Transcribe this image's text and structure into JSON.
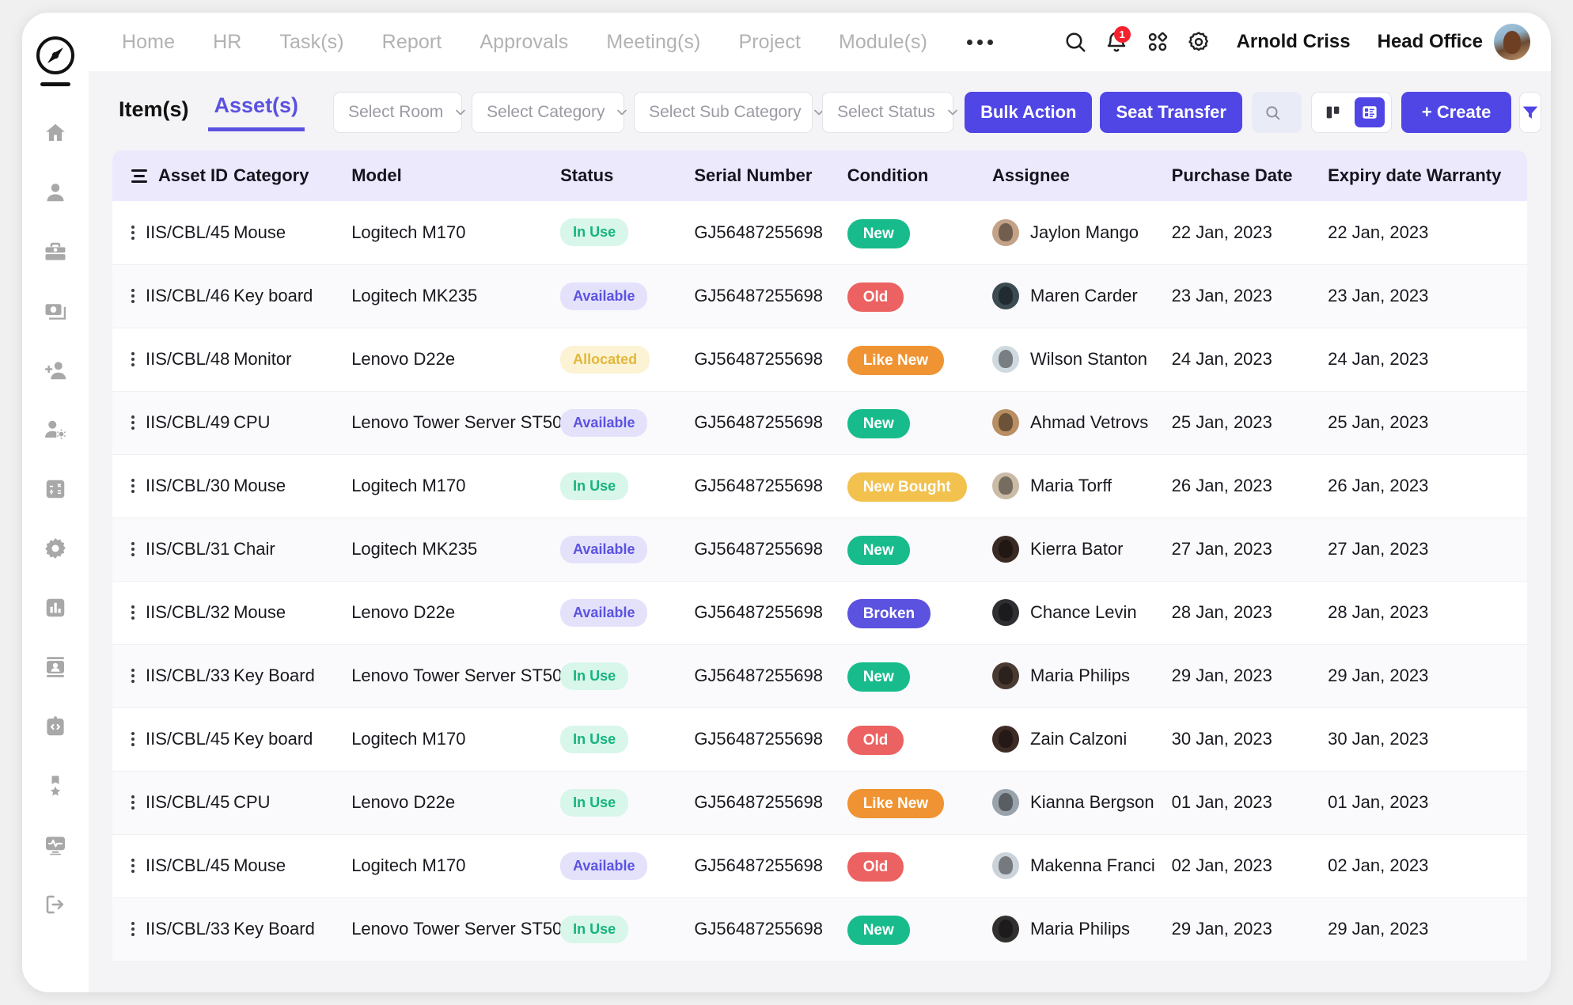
{
  "topnav": {
    "items": [
      {
        "label": "Home"
      },
      {
        "label": "HR"
      },
      {
        "label": "Task(s)"
      },
      {
        "label": "Report"
      },
      {
        "label": "Approvals"
      },
      {
        "label": "Meeting(s)"
      },
      {
        "label": "Project"
      },
      {
        "label": "Module(s)"
      }
    ],
    "overflow_label": "•••",
    "notification_count": "1",
    "user_name": "Arnold Criss",
    "office_name": "Head Office"
  },
  "sidebar": {
    "items": [
      {
        "icon": "compass-logo-icon",
        "label": "Logo"
      },
      {
        "icon": "home-icon",
        "label": "Home"
      },
      {
        "icon": "user-icon",
        "label": "Profile"
      },
      {
        "icon": "briefcase-icon",
        "label": "Jobs"
      },
      {
        "icon": "payment-icon",
        "label": "Payroll"
      },
      {
        "icon": "add-user-icon",
        "label": "Add User"
      },
      {
        "icon": "user-settings-icon",
        "label": "User Settings"
      },
      {
        "icon": "calculator-icon",
        "label": "Accounts"
      },
      {
        "icon": "gear-icon",
        "label": "Settings"
      },
      {
        "icon": "chart-icon",
        "label": "Reports"
      },
      {
        "icon": "contact-card-icon",
        "label": "Contacts"
      },
      {
        "icon": "code-clipboard-icon",
        "label": "Developer"
      },
      {
        "icon": "award-icon",
        "label": "Awards"
      },
      {
        "icon": "activity-monitor-icon",
        "label": "Monitoring"
      },
      {
        "icon": "logout-icon",
        "label": "Logout"
      }
    ]
  },
  "toolbar": {
    "tabs": [
      {
        "label": "Item(s)",
        "active": false
      },
      {
        "label": "Asset(s)",
        "active": true
      }
    ],
    "selects": [
      {
        "placeholder": "Select Room"
      },
      {
        "placeholder": "Select Category"
      },
      {
        "placeholder": "Select Sub Category"
      },
      {
        "placeholder": "Select Status"
      }
    ],
    "bulk_action_label": "Bulk Action",
    "seat_transfer_label": "Seat Transfer",
    "search_placeholder": "Search",
    "search_value": "",
    "create_label": "+ Create",
    "view_board_label": "Board view",
    "view_list_label": "List view",
    "filter_label": "Filter"
  },
  "table": {
    "columns": [
      "Asset ID",
      "Category",
      "Model",
      "Status",
      "Serial Number",
      "Condition",
      "Assignee",
      "Purchase Date",
      "Expiry date Warranty"
    ],
    "rows": [
      {
        "asset_id": "IIS/CBL/45",
        "category": "Mouse",
        "model": "Logitech M170",
        "status": "In Use",
        "serial": "GJ56487255698",
        "condition": "New",
        "assignee": "Jaylon Mango",
        "purchase_date": "22 Jan, 2023",
        "expiry_date": "22 Jan, 2023"
      },
      {
        "asset_id": "IIS/CBL/46",
        "category": "Key board",
        "model": "Logitech MK235",
        "status": "Available",
        "serial": "GJ56487255698",
        "condition": "Old",
        "assignee": "Maren Carder",
        "purchase_date": "23 Jan, 2023",
        "expiry_date": "23 Jan, 2023"
      },
      {
        "asset_id": "IIS/CBL/48",
        "category": "Monitor",
        "model": "Lenovo D22e",
        "status": "Allocated",
        "serial": "GJ56487255698",
        "condition": "Like New",
        "assignee": "Wilson Stanton",
        "purchase_date": "24 Jan, 2023",
        "expiry_date": "24 Jan, 2023"
      },
      {
        "asset_id": "IIS/CBL/49",
        "category": "CPU",
        "model": "Lenovo Tower Server ST50",
        "status": "Available",
        "serial": "GJ56487255698",
        "condition": "New",
        "assignee": "Ahmad Vetrovs",
        "purchase_date": "25 Jan, 2023",
        "expiry_date": "25 Jan, 2023"
      },
      {
        "asset_id": "IIS/CBL/30",
        "category": "Mouse",
        "model": "Logitech M170",
        "status": "In Use",
        "serial": "GJ56487255698",
        "condition": "New Bought",
        "assignee": "Maria Torff",
        "purchase_date": "26 Jan, 2023",
        "expiry_date": "26 Jan, 2023"
      },
      {
        "asset_id": "IIS/CBL/31",
        "category": "Chair",
        "model": "Logitech MK235",
        "status": "Available",
        "serial": "GJ56487255698",
        "condition": "New",
        "assignee": "Kierra Bator",
        "purchase_date": "27 Jan, 2023",
        "expiry_date": "27 Jan, 2023"
      },
      {
        "asset_id": "IIS/CBL/32",
        "category": "Mouse",
        "model": "Lenovo D22e",
        "status": "Available",
        "serial": "GJ56487255698",
        "condition": "Broken",
        "assignee": "Chance Levin",
        "purchase_date": "28 Jan, 2023",
        "expiry_date": "28 Jan, 2023"
      },
      {
        "asset_id": "IIS/CBL/33",
        "category": "Key Board",
        "model": "Lenovo Tower Server ST50",
        "status": "In Use",
        "serial": "GJ56487255698",
        "condition": "New",
        "assignee": "Maria Philips",
        "purchase_date": "29 Jan, 2023",
        "expiry_date": "29 Jan, 2023"
      },
      {
        "asset_id": "IIS/CBL/45",
        "category": "Key board",
        "model": "Logitech M170",
        "status": "In Use",
        "serial": "GJ56487255698",
        "condition": "Old",
        "assignee": "Zain Calzoni",
        "purchase_date": "30 Jan, 2023",
        "expiry_date": "30 Jan, 2023"
      },
      {
        "asset_id": "IIS/CBL/45",
        "category": "CPU",
        "model": "Lenovo D22e",
        "status": "In Use",
        "serial": "GJ56487255698",
        "condition": "Like New",
        "assignee": "Kianna Bergson",
        "purchase_date": "01 Jan, 2023",
        "expiry_date": "01 Jan, 2023"
      },
      {
        "asset_id": "IIS/CBL/45",
        "category": "Mouse",
        "model": "Logitech M170",
        "status": "Available",
        "serial": "GJ56487255698",
        "condition": "Old",
        "assignee": "Makenna Franci",
        "purchase_date": "02 Jan, 2023",
        "expiry_date": "02 Jan, 2023"
      },
      {
        "asset_id": "IIS/CBL/33",
        "category": "Key Board",
        "model": "Lenovo Tower Server ST50",
        "status": "In Use",
        "serial": "GJ56487255698",
        "condition": "New",
        "assignee": "Maria Philips",
        "purchase_date": "29 Jan, 2023",
        "expiry_date": "29 Jan, 2023"
      }
    ]
  },
  "colors": {
    "accent": "#4f46e5",
    "tab_active": "#5b52e0",
    "header_bg": "#ece9fd",
    "status_inuse_bg": "#d8f6ea",
    "status_inuse_fg": "#16b47f",
    "status_available_bg": "#e4e2fb",
    "status_available_fg": "#5b52e0",
    "status_allocated_bg": "#fcf3d4",
    "status_allocated_fg": "#e3b73a",
    "cond_new": "#18bc8c",
    "cond_old": "#ec6161",
    "cond_like_new": "#f09433",
    "cond_new_bought": "#f2c14e",
    "cond_broken": "#5b52e0"
  }
}
